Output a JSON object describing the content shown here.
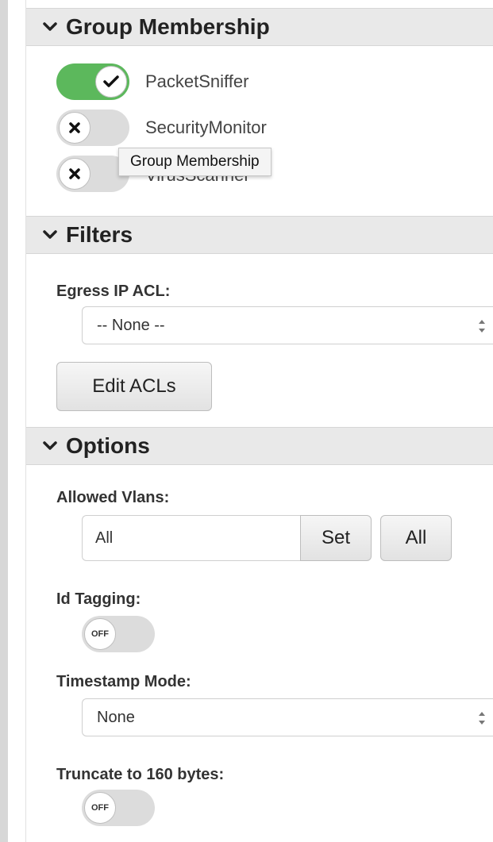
{
  "sections": {
    "group_membership": {
      "title": "Group Membership"
    },
    "filters": {
      "title": "Filters"
    },
    "options": {
      "title": "Options"
    }
  },
  "group_membership": {
    "items": [
      {
        "label": "PacketSniffer",
        "state": "on"
      },
      {
        "label": "SecurityMonitor",
        "state": "off"
      },
      {
        "label": "VirusScanner",
        "state": "off"
      }
    ],
    "tooltip": "Group Membership"
  },
  "filters": {
    "egress_label": "Egress IP ACL:",
    "egress_value": "-- None --",
    "edit_button": "Edit ACLs"
  },
  "options": {
    "allowed_vlans_label": "Allowed Vlans:",
    "allowed_vlans_value": "All",
    "set_button": "Set",
    "all_button": "All",
    "id_tagging_label": "Id Tagging:",
    "id_tagging_state": "OFF",
    "timestamp_label": "Timestamp Mode:",
    "timestamp_value": "None",
    "truncate_label": "Truncate to 160 bytes:",
    "truncate_state": "OFF"
  },
  "colors": {
    "toggle_on": "#5cb85c",
    "toggle_off": "#dcdcdc",
    "header_bg": "#e9e9e9"
  }
}
